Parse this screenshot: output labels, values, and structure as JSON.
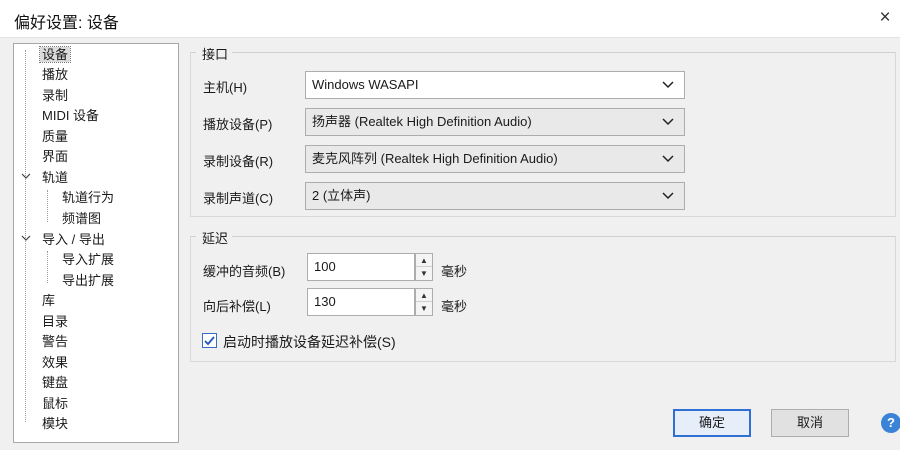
{
  "window": {
    "title": "偏好设置: 设备",
    "close_glyph": "×"
  },
  "tree": {
    "items": [
      {
        "label": "设备",
        "selected": true
      },
      {
        "label": "播放"
      },
      {
        "label": "录制"
      },
      {
        "label": "MIDI 设备"
      },
      {
        "label": "质量"
      },
      {
        "label": "界面"
      },
      {
        "label": "轨道",
        "expanded": true
      },
      {
        "label": "轨道行为"
      },
      {
        "label": "频谱图"
      },
      {
        "label": "导入 / 导出",
        "expanded": true
      },
      {
        "label": "导入扩展"
      },
      {
        "label": "导出扩展"
      },
      {
        "label": "库"
      },
      {
        "label": "目录"
      },
      {
        "label": "警告"
      },
      {
        "label": "效果"
      },
      {
        "label": "键盘"
      },
      {
        "label": "鼠标"
      },
      {
        "label": "模块"
      }
    ]
  },
  "interface": {
    "group_title": "接口",
    "host_label": "主机(H)",
    "host_value": "Windows WASAPI",
    "playback_label": "播放设备(P)",
    "playback_value": "扬声器 (Realtek High Definition Audio)",
    "record_label": "录制设备(R)",
    "record_value": "麦克风阵列 (Realtek High Definition Audio)",
    "channels_label": "录制声道(C)",
    "channels_value": "2 (立体声)"
  },
  "latency": {
    "group_title": "延迟",
    "buffer_label": "缓冲的音频(B)",
    "buffer_value": "100",
    "buffer_unit": "毫秒",
    "comp_label": "向后补偿(L)",
    "comp_value": "130",
    "comp_unit": "毫秒",
    "autocomp_label": "启动时播放设备延迟补偿(S)",
    "autocomp_checked": true
  },
  "buttons": {
    "ok": "确定",
    "cancel": "取消",
    "help": "?"
  },
  "colors": {
    "accent": "#2f6fd6",
    "help_blue": "#3b83d6"
  }
}
